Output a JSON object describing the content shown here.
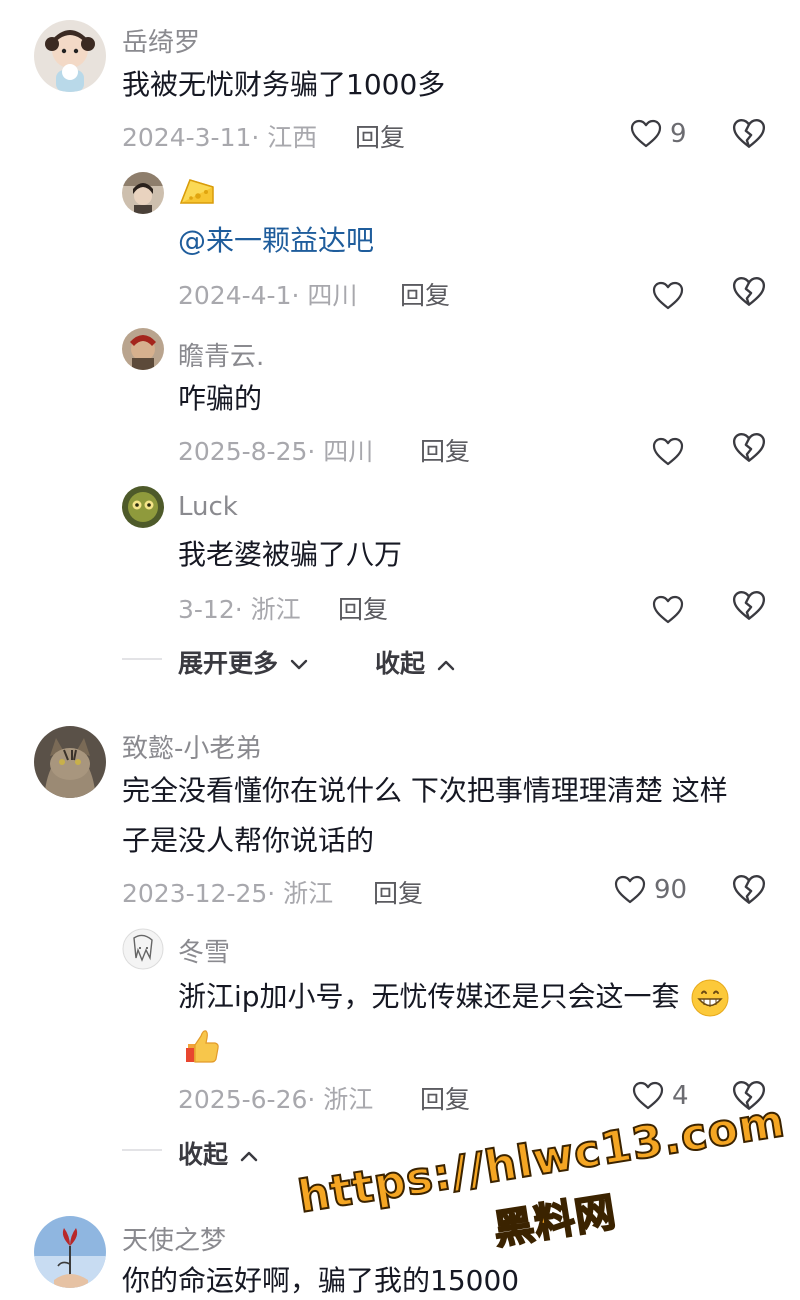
{
  "comments": [
    {
      "name": "岳绮罗",
      "text": "我被无忧财务骗了1000多",
      "meta": "2024-3-11· 江西",
      "reply": "回复",
      "likes": "9",
      "replies": [
        {
          "mention": "@来一颗益达吧",
          "meta": "2024-4-1· 四川",
          "reply": "回复"
        },
        {
          "name": "瞻青云.",
          "text": "咋骗的",
          "meta": "2025-8-25· 四川",
          "reply": "回复"
        },
        {
          "name": "Luck",
          "text": "我老婆被骗了八万",
          "meta": "3-12· 浙江",
          "reply": "回复"
        }
      ],
      "expand_more": "展开更多",
      "collapse": "收起"
    },
    {
      "name": "致懿-小老弟",
      "text_line1": "完全没看懂你在说什么 下次把事情理理清楚 这样",
      "text_line2": "子是没人帮你说话的",
      "meta": "2023-12-25· 浙江",
      "reply": "回复",
      "likes": "90",
      "replies": [
        {
          "name": "冬雪",
          "text": "浙江ip加小号，无忧传媒还是只会这一套",
          "meta": "2025-6-26· 浙江",
          "reply": "回复",
          "likes": "4"
        }
      ],
      "collapse": "收起"
    },
    {
      "name": "天使之梦",
      "text": "你的命运好啊，骗了我的15000"
    }
  ],
  "watermark": {
    "url": "https://hlwc13.com",
    "label": "黑料网"
  },
  "icons": {
    "like": "heart-outline-icon",
    "dislike": "broken-heart-icon",
    "chevron_down": "chevron-down-icon",
    "chevron_up": "chevron-up-icon"
  },
  "colors": {
    "name": "#8a8a8f",
    "text": "#161823",
    "mention": "#1f5d9c",
    "meta": "#a8a8ad",
    "watermark": "#f5a623"
  }
}
